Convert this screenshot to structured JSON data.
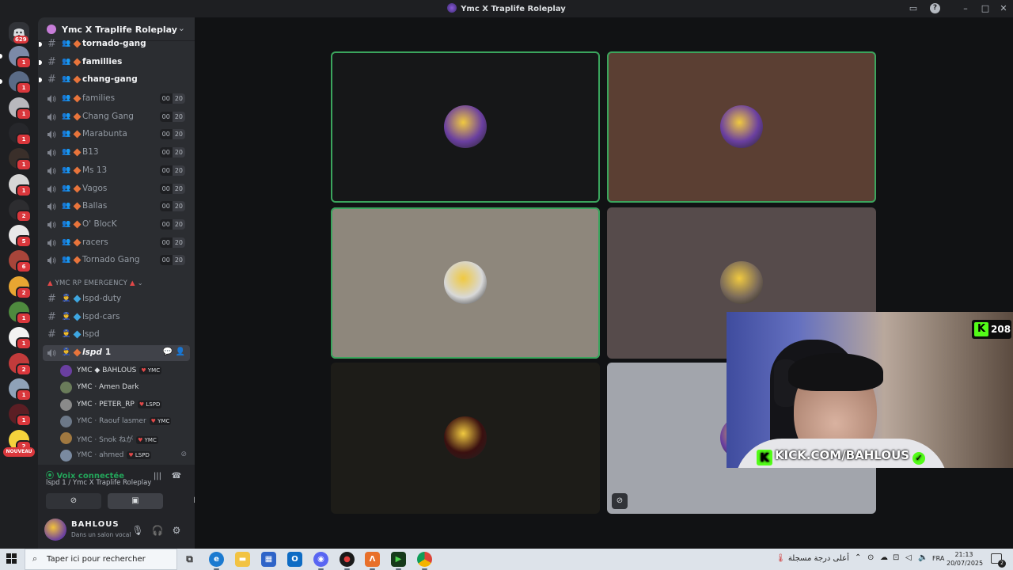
{
  "window": {
    "title": "Ymc X Traplife Roleplay"
  },
  "rail": {
    "home_badge": "629",
    "servers": [
      {
        "badge": "1",
        "color": "#7c8aa8",
        "pill": true
      },
      {
        "badge": "1",
        "color": "#5a6b86",
        "pill": true
      },
      {
        "badge": "1",
        "color": "#b8b8bd",
        "pill": false
      },
      {
        "badge": "1",
        "color": "#26272b",
        "pill": false
      },
      {
        "badge": "1",
        "color": "#3a2f2a",
        "pill": false
      },
      {
        "badge": "1",
        "color": "#d6d6d6",
        "pill": false
      },
      {
        "badge": "2",
        "color": "#2d2d30",
        "pill": false
      },
      {
        "badge": "5",
        "color": "#e8e8e8",
        "pill": false
      },
      {
        "badge": "6",
        "color": "#a8453a",
        "pill": false
      },
      {
        "badge": "2",
        "color": "#e8a632",
        "pill": false
      },
      {
        "badge": "1",
        "color": "#4e8a3e",
        "pill": false
      },
      {
        "badge": "1",
        "color": "#f2f2f2",
        "pill": false
      },
      {
        "badge": "2",
        "color": "#c23b3b",
        "pill": false
      },
      {
        "badge": "1",
        "color": "#8fa2b8",
        "pill": false
      },
      {
        "badge": "1",
        "color": "#5b1e24",
        "pill": false
      },
      {
        "badge": "2",
        "color": "#f5d33c",
        "pill": false
      }
    ],
    "new_label": "NOUVEAU"
  },
  "server": {
    "name": "Ymc X Traplife Roleplay"
  },
  "text_channels_top": [
    {
      "name": "tornado-gang"
    },
    {
      "name": "famillies"
    },
    {
      "name": "chang-gang"
    }
  ],
  "voice_channels": [
    {
      "name": "families",
      "count": "00",
      "limit": "20"
    },
    {
      "name": "Chang Gang",
      "count": "00",
      "limit": "20"
    },
    {
      "name": "Marabunta",
      "count": "00",
      "limit": "20"
    },
    {
      "name": "B13",
      "count": "00",
      "limit": "20"
    },
    {
      "name": "Ms 13",
      "count": "00",
      "limit": "20"
    },
    {
      "name": "Vagos",
      "count": "00",
      "limit": "20"
    },
    {
      "name": "Ballas",
      "count": "00",
      "limit": "20"
    },
    {
      "name": "O' BlocK",
      "count": "00",
      "limit": "20"
    },
    {
      "name": "racers",
      "count": "00",
      "limit": "20"
    },
    {
      "name": "Tornado Gang",
      "count": "00",
      "limit": "20"
    }
  ],
  "emergency_category": {
    "label": "YMC RP EMERGENCY",
    "channels": [
      {
        "name": "lspd-duty"
      },
      {
        "name": "lspd-cars"
      },
      {
        "name": "lspd"
      }
    ]
  },
  "active_voice": {
    "name": "lspd",
    "count": "1",
    "members": [
      {
        "name": "YMC ◆ BAHLOUS",
        "tag": "YMC",
        "dim": false,
        "color": "#6a3fa0"
      },
      {
        "name": "YMC · Amen Dark",
        "tag": "",
        "dim": false,
        "color": "#6a7c5a"
      },
      {
        "name": "YMC · PETER_RP",
        "tag": "LSPD",
        "dim": false,
        "color": "#8a8a8a"
      },
      {
        "name": "YMC · Raouf lasmer",
        "tag": "YMC",
        "dim": true,
        "color": "#6c7888"
      },
      {
        "name": "YMC · Snok ねが",
        "tag": "YMC",
        "dim": true,
        "color": "#a07840"
      },
      {
        "name": "YMC · ahmed",
        "tag": "LSPD",
        "dim": true,
        "color": "#7a8aa0"
      }
    ]
  },
  "voice_panel": {
    "status": "Voix connectée",
    "location": "lspd 1 / Ymc X Traplife Roleplay"
  },
  "user_panel": {
    "username": "BAHLOUS",
    "status": "Dans un salon vocal"
  },
  "tiles": [
    {
      "bg": "#161718",
      "speaking": true,
      "avatar": "#6a3fa0"
    },
    {
      "bg": "#5b3f33",
      "speaking": true,
      "avatar": "#6a3fa0"
    },
    {
      "bg": "#8e877c",
      "speaking": true,
      "avatar": "#d8d8d8"
    },
    {
      "bg": "#564b4b",
      "speaking": false,
      "avatar": "#7a6a5a"
    },
    {
      "bg": "#1d1c18",
      "speaking": false,
      "avatar": "#3a1010"
    },
    {
      "bg": "#a2a5ac",
      "speaking": false,
      "avatar": "#6a3fa0"
    }
  ],
  "stream_overlay": {
    "kick_url": "KICK.COM/BAHLOUS",
    "viewers": "208"
  },
  "taskbar": {
    "search_placeholder": "Taper ici pour rechercher",
    "weather": "أعلى درجة مسجلة",
    "language": "FRA",
    "time": "21:13",
    "date": "20/07/2025",
    "notification_count": "2"
  }
}
